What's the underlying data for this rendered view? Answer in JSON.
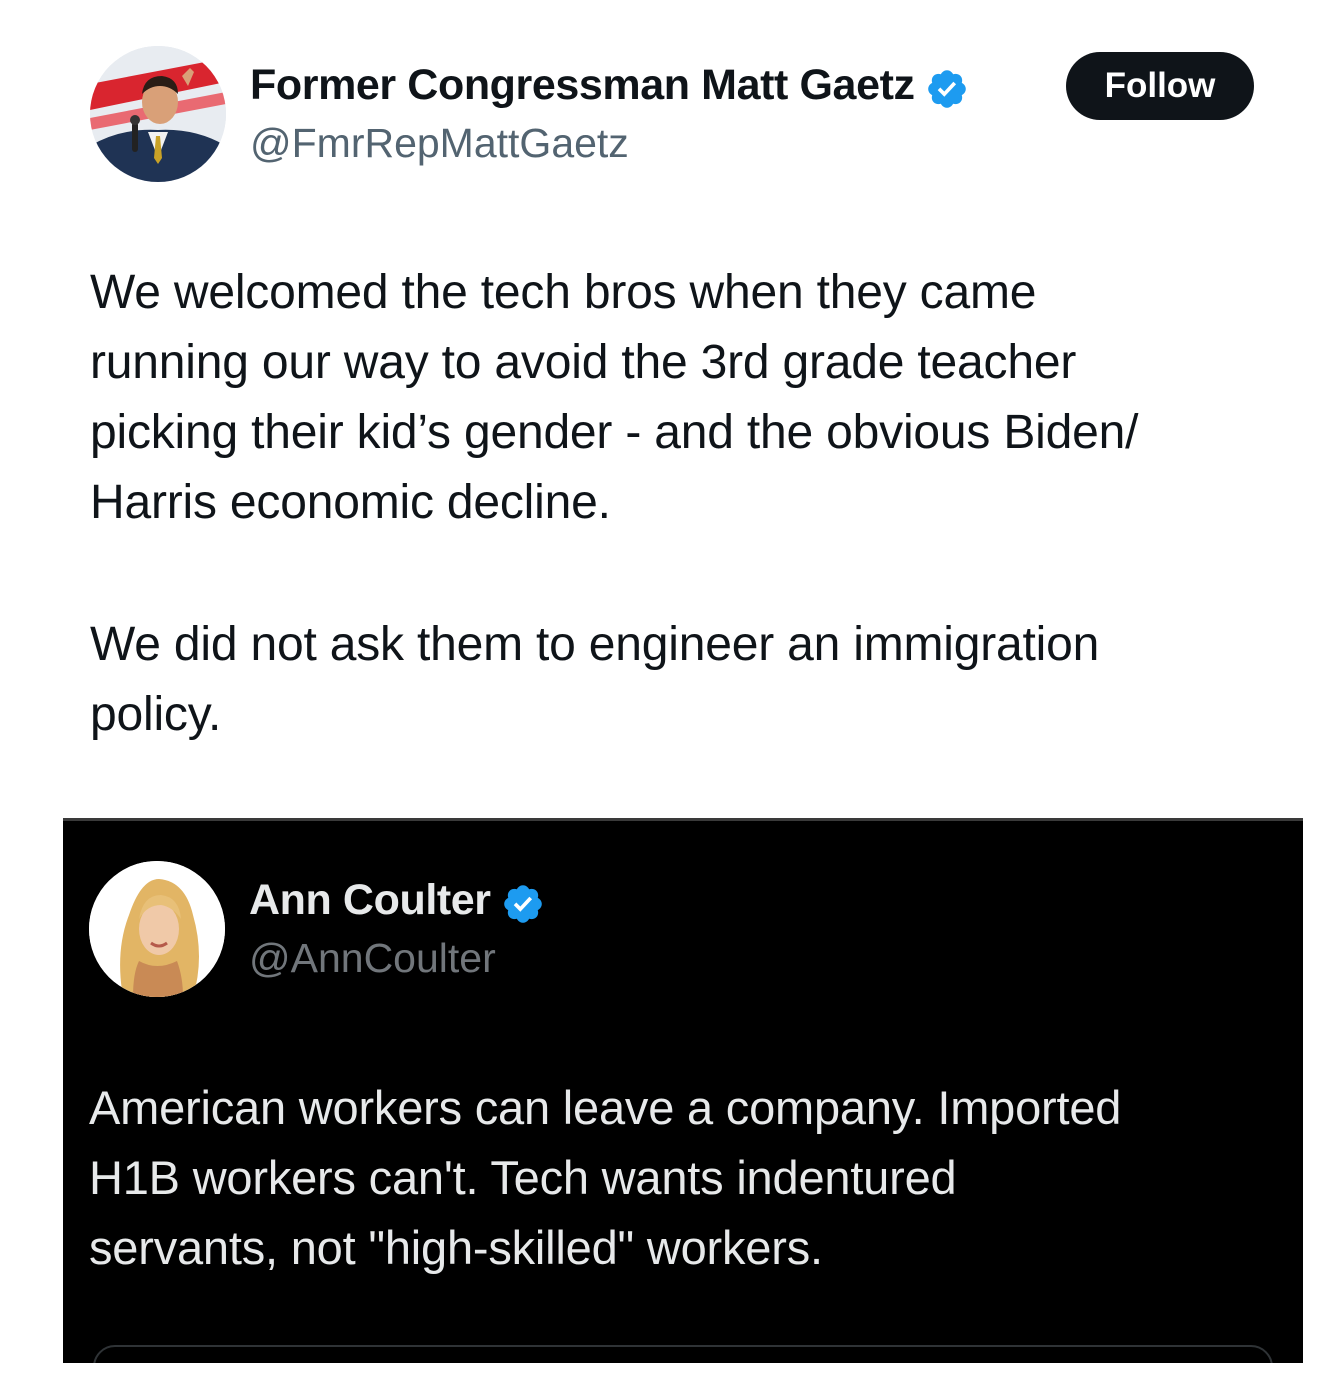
{
  "tweet": {
    "author": {
      "display_name": "Former Congressman Matt Gaetz",
      "handle": "@FmrRepMattGaetz",
      "verified_icon": "verified-badge-icon",
      "avatar": "profile-photo"
    },
    "follow_label": "Follow",
    "text_para1": "We welcomed the tech bros when they came\nrunning our way to avoid the 3rd grade teacher\npicking their kid’s gender - and the obvious Biden/\nHarris economic decline.",
    "text_para2": "We did not ask them to engineer an immigration\npolicy."
  },
  "quoted_tweet": {
    "author": {
      "display_name": "Ann Coulter",
      "handle": "@AnnCoulter",
      "verified_icon": "verified-badge-icon",
      "avatar": "profile-photo"
    },
    "text": "American workers can leave a company.  Imported\nH1B workers can't.  Tech wants indentured\nservants, not \"high-skilled\" workers."
  },
  "colors": {
    "verified_blue": "#1d9bf0",
    "text_primary_light": "#0f1419",
    "text_secondary_light": "#536471",
    "text_primary_dark": "#e7e9ea",
    "text_secondary_dark": "#71767b",
    "follow_button_bg": "#0f1419"
  }
}
